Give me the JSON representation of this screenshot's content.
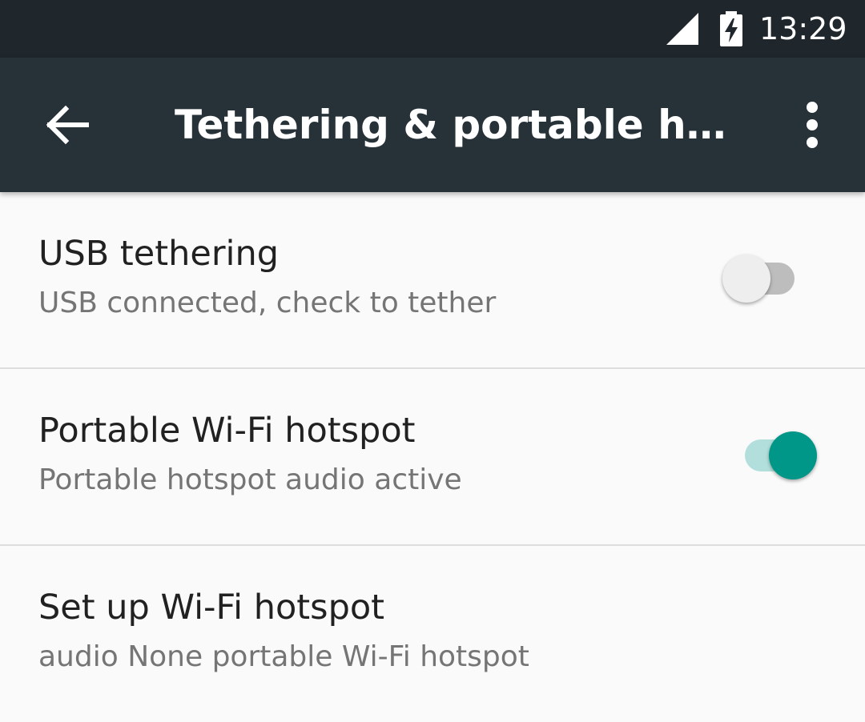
{
  "status_bar": {
    "time": "13:29",
    "signal_icon": "cell-signal-icon",
    "battery_icon": "battery-charging-icon"
  },
  "toolbar": {
    "title": "Tethering & portable hotspot",
    "back_icon": "arrow-back-icon",
    "overflow_icon": "more-vert-icon"
  },
  "settings": {
    "items": [
      {
        "title": "USB tethering",
        "summary": "USB connected, check to tether",
        "switch_on": false
      },
      {
        "title": "Portable Wi-Fi hotspot",
        "summary": "Portable hotspot audio active",
        "switch_on": true
      },
      {
        "title": "Set up Wi-Fi hotspot",
        "summary": "audio None portable Wi-Fi hotspot"
      }
    ]
  },
  "colors": {
    "status_bar": "#1f272c",
    "toolbar": "#263238",
    "accent": "#009688",
    "accent_track": "#b2dfdb",
    "switch_off_thumb": "#eeeeee",
    "switch_off_track": "#bdbdbd"
  }
}
